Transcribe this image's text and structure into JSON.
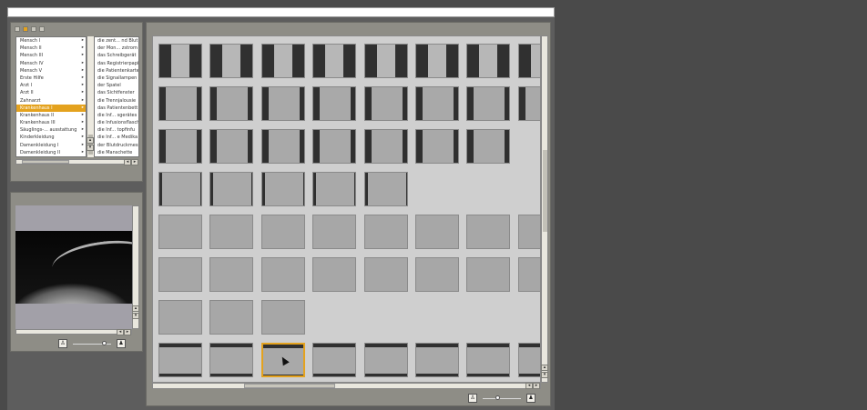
{
  "browser_tree": {
    "categories": [
      "Mensch I",
      "Mensch II",
      "Mensch III",
      "Mensch IV",
      "Mensch V",
      "Erste Hilfe",
      "Arzt I",
      "Arzt II",
      "Zahnarzt",
      "Krankenhaus I",
      "Krankenhaus II",
      "Krankenhaus III",
      "Säuglings-... ausstattung",
      "Kinderkleidung",
      "Damenkleidung I",
      "Damenkleidung II"
    ],
    "selected_index": 9,
    "items": [
      "die zent... nd Blut",
      "der Mon... zstrom",
      "das Schreibgerät",
      "das Registrierpapier",
      "die Patientenkarte",
      "die Signallampen",
      "der Spatel",
      "das Sichtfenster",
      "die Trennjalousie",
      "das Patientenbett",
      "die Inf... sgerätes",
      "die Infusionsflasche",
      "die Inf... topfinfu",
      "die Inf... e Medika",
      "der Blutdruckmesser",
      "die Manschette"
    ]
  },
  "icons": {
    "window_buttons": [
      "close-icon",
      "minimize-icon",
      "zoom-icon",
      "collapse-icon"
    ],
    "scroll_arrows": [
      "arrow-left-icon",
      "arrow-right-icon",
      "arrow-up-icon",
      "arrow-down-icon"
    ],
    "size_small": "person-small-icon",
    "size_large": "person-large-icon"
  },
  "colors": {
    "accent": "#e4a21e",
    "panel": "#8e8d86",
    "desktop": "#4a4a4a"
  }
}
